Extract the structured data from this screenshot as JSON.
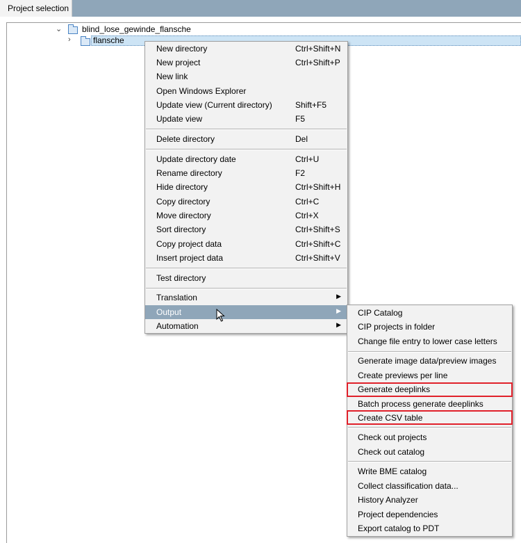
{
  "tab": {
    "label": "Project selection"
  },
  "tree": {
    "root": {
      "label": "blind_lose_gewinde_flansche",
      "expander": "chevron-down-icon",
      "icon": "folder-open-icon"
    },
    "child": {
      "label": "flansche",
      "expander": "chevron-right-icon",
      "icon": "folder-icon"
    }
  },
  "context_menu": {
    "items": [
      {
        "label": "New directory",
        "shortcut": "Ctrl+Shift+N"
      },
      {
        "label": "New project",
        "shortcut": "Ctrl+Shift+P"
      },
      {
        "label": "New link",
        "shortcut": ""
      },
      {
        "label": "Open Windows Explorer",
        "shortcut": ""
      },
      {
        "label": "Update view (Current directory)",
        "shortcut": "Shift+F5"
      },
      {
        "label": "Update view",
        "shortcut": "F5"
      },
      {
        "label": "Delete directory",
        "shortcut": "Del"
      },
      {
        "label": "Update directory date",
        "shortcut": "Ctrl+U"
      },
      {
        "label": "Rename directory",
        "shortcut": "F2"
      },
      {
        "label": "Hide directory",
        "shortcut": "Ctrl+Shift+H"
      },
      {
        "label": "Copy directory",
        "shortcut": "Ctrl+C"
      },
      {
        "label": "Move directory",
        "shortcut": "Ctrl+X"
      },
      {
        "label": "Sort directory",
        "shortcut": "Ctrl+Shift+S"
      },
      {
        "label": "Copy project data",
        "shortcut": "Ctrl+Shift+C"
      },
      {
        "label": "Insert project data",
        "shortcut": "Ctrl+Shift+V"
      },
      {
        "label": "Test directory",
        "shortcut": ""
      },
      {
        "label": "Translation",
        "shortcut": ""
      },
      {
        "label": "Output",
        "shortcut": ""
      },
      {
        "label": "Automation",
        "shortcut": ""
      }
    ]
  },
  "output_submenu": {
    "items": [
      {
        "label": "CIP Catalog"
      },
      {
        "label": "CIP projects in folder"
      },
      {
        "label": "Change file entry to lower case letters"
      },
      {
        "label": "Generate image data/preview images"
      },
      {
        "label": "Create previews per line"
      },
      {
        "label": "Generate deeplinks"
      },
      {
        "label": "Batch process generate deeplinks"
      },
      {
        "label": "Create CSV table"
      },
      {
        "label": "Check out projects"
      },
      {
        "label": "Check out catalog"
      },
      {
        "label": "Write BME catalog"
      },
      {
        "label": "Collect classification data..."
      },
      {
        "label": "History Analyzer"
      },
      {
        "label": "Project dependencies"
      },
      {
        "label": "Export catalog to PDT"
      }
    ]
  },
  "colors": {
    "header_bar": "#8fa6b9",
    "highlight": "#8fa6b9",
    "selection": "#cde4f5",
    "annotation_box": "#e0202a"
  }
}
